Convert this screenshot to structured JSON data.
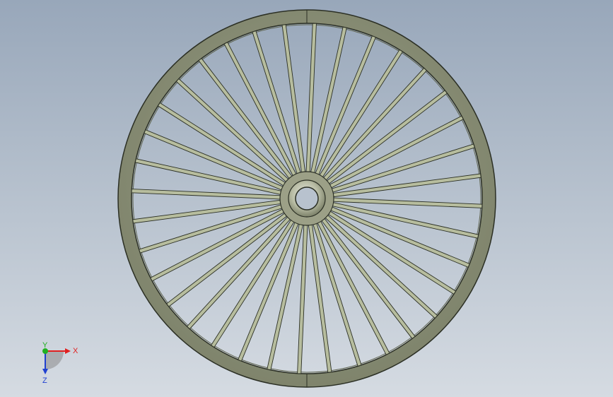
{
  "viewport": {
    "background_top": "#98a7ba",
    "background_bottom": "#d5dbe2"
  },
  "model": {
    "name": "spoked-wheel",
    "spoke_count": 36,
    "rim_color": "#8a9078",
    "rim_edge_color": "#2b2f24",
    "spoke_color": "#b7bd9e",
    "hub_color": "#9ca087",
    "hub_highlight_color": "#e6e8dc"
  },
  "triad": {
    "x_label": "X",
    "y_label": "Y",
    "z_label": "Z",
    "x_color": "#e02020",
    "y_color": "#20b020",
    "z_color": "#2040d0"
  }
}
